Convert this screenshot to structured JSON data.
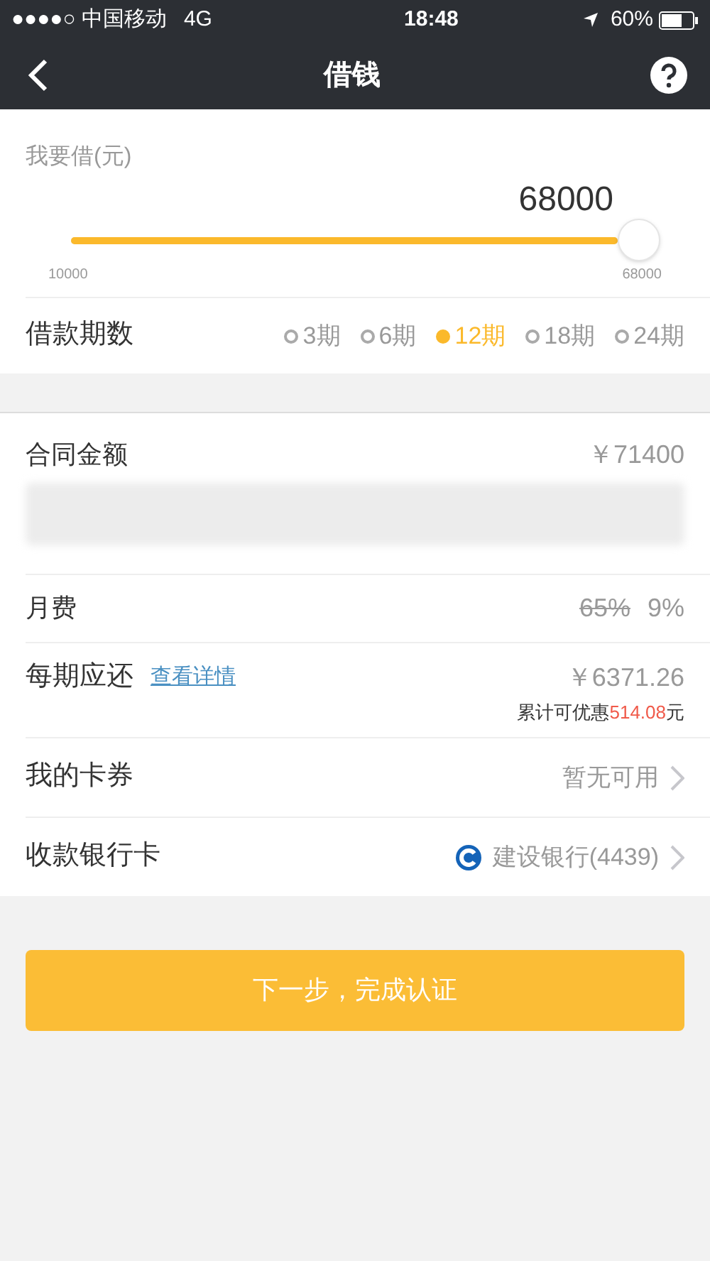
{
  "status_bar": {
    "carrier": "●●●●○ 中国移动",
    "network": "4G",
    "time": "18:48",
    "battery": "60%"
  },
  "nav": {
    "title": "借钱"
  },
  "amount": {
    "label": "我要借(元)",
    "value": "68000",
    "level": 1,
    "min": "10000",
    "max": "68000"
  },
  "periods": {
    "label": "借款期数",
    "options": [
      {
        "label": "3期",
        "selected": false
      },
      {
        "label": "6期",
        "selected": false
      },
      {
        "label": "12期",
        "selected": true
      },
      {
        "label": "18期",
        "selected": false
      },
      {
        "label": "24期",
        "selected": false
      }
    ]
  },
  "contract": {
    "label": "合同金额",
    "value": "￥71400"
  },
  "rate": {
    "label": "月费",
    "old_value": "65%",
    "value": "9%"
  },
  "installment": {
    "label": "每期应还",
    "link": "查看详情",
    "value": "￥6371.26",
    "discount_prefix": "累计可优惠",
    "discount": "514.08",
    "discount_suffix": "元"
  },
  "rows": [
    {
      "kind": "coupon",
      "label": "我的卡券",
      "value": "暂无可用"
    },
    {
      "kind": "bank",
      "label": "收款银行卡",
      "value": "建设银行(4439)"
    }
  ],
  "submit": "下一步，完成认证"
}
